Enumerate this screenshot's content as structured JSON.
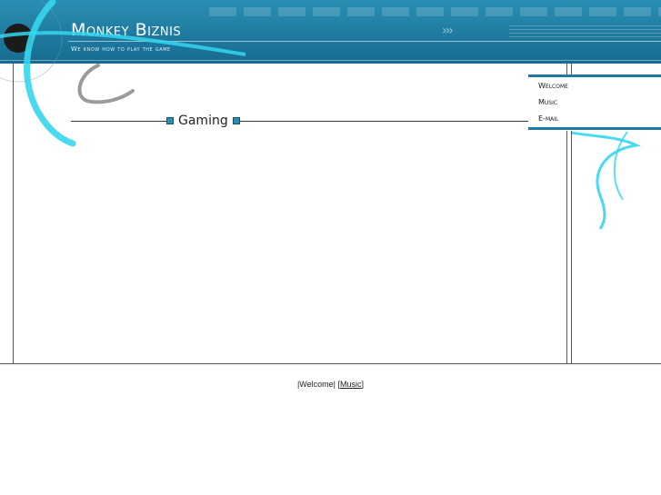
{
  "site": {
    "title": "Monkey Biznis",
    "tagline": "We know how to play the game"
  },
  "header": {
    "chevrons": "›››"
  },
  "main": {
    "section_title": "Gaming"
  },
  "nav": {
    "items": [
      {
        "label": "Welcome"
      },
      {
        "label": "Music"
      },
      {
        "label": "E-mail"
      }
    ]
  },
  "footer": {
    "open_bracket": "|",
    "welcome": "Welcome",
    "separator": "| [",
    "music": "Music",
    "close_bracket": "]"
  },
  "colors": {
    "header_blue": "#1f7aa0",
    "accent_cyan": "#35d6ee"
  }
}
